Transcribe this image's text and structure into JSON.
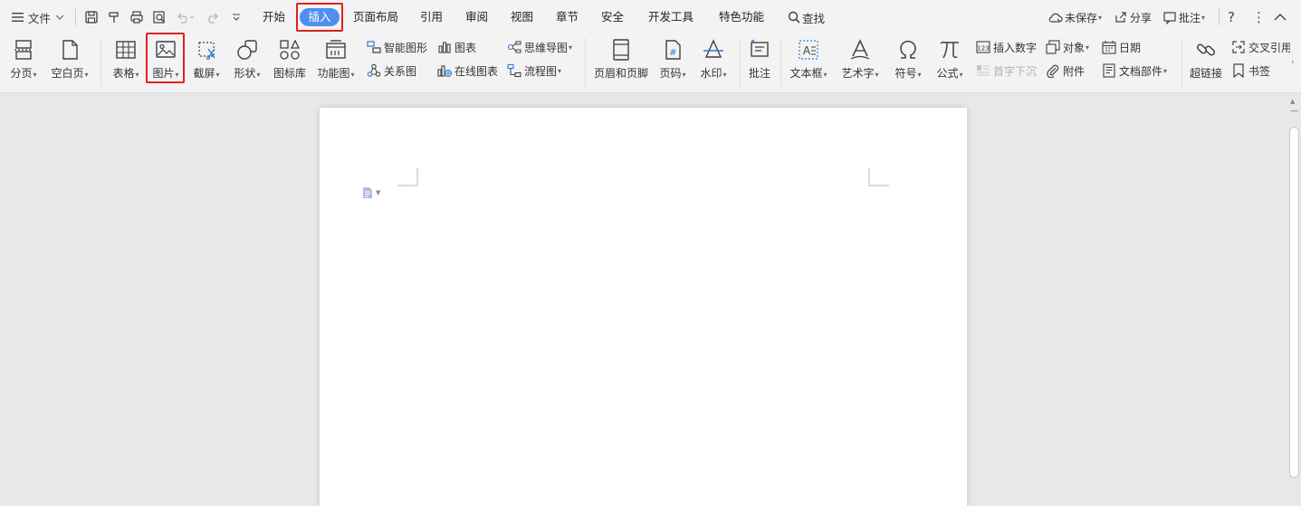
{
  "menu": {
    "file_label": "文件"
  },
  "tabs": [
    {
      "label": "开始"
    },
    {
      "label": "插入"
    },
    {
      "label": "页面布局"
    },
    {
      "label": "引用"
    },
    {
      "label": "审阅"
    },
    {
      "label": "视图"
    },
    {
      "label": "章节"
    },
    {
      "label": "安全"
    },
    {
      "label": "开发工具"
    },
    {
      "label": "特色功能"
    }
  ],
  "active_tab": "插入",
  "search_label": "查找",
  "right_actions": {
    "unsaved": "未保存",
    "share": "分享",
    "comment": "批注"
  },
  "ribbon": {
    "page_break": "分页",
    "blank_page": "空白页",
    "table": "表格",
    "picture": "图片",
    "screenshot": "截屏",
    "shape": "形状",
    "icon_library": "图标库",
    "function_chart": "功能图",
    "smart_shape": "智能图形",
    "relation_chart": "关系图",
    "chart": "图表",
    "online_chart": "在线图表",
    "mind_map": "思维导图",
    "flowchart": "流程图",
    "header_footer": "页眉和页脚",
    "page_number": "页码",
    "watermark": "水印",
    "comment": "批注",
    "text_box": "文本框",
    "word_art": "艺术字",
    "symbol": "符号",
    "formula": "公式",
    "insert_number": "插入数字",
    "drop_cap": "首字下沉",
    "object": "对象",
    "attachment": "附件",
    "date": "日期",
    "doc_parts": "文档部件",
    "hyperlink": "超链接",
    "cross_ref": "交叉引用",
    "bookmark": "书签"
  },
  "colors": {
    "accent": "#4f8ff0",
    "highlight": "#e02020",
    "icon": "#404040",
    "blue_icon": "#2f7bd9"
  }
}
